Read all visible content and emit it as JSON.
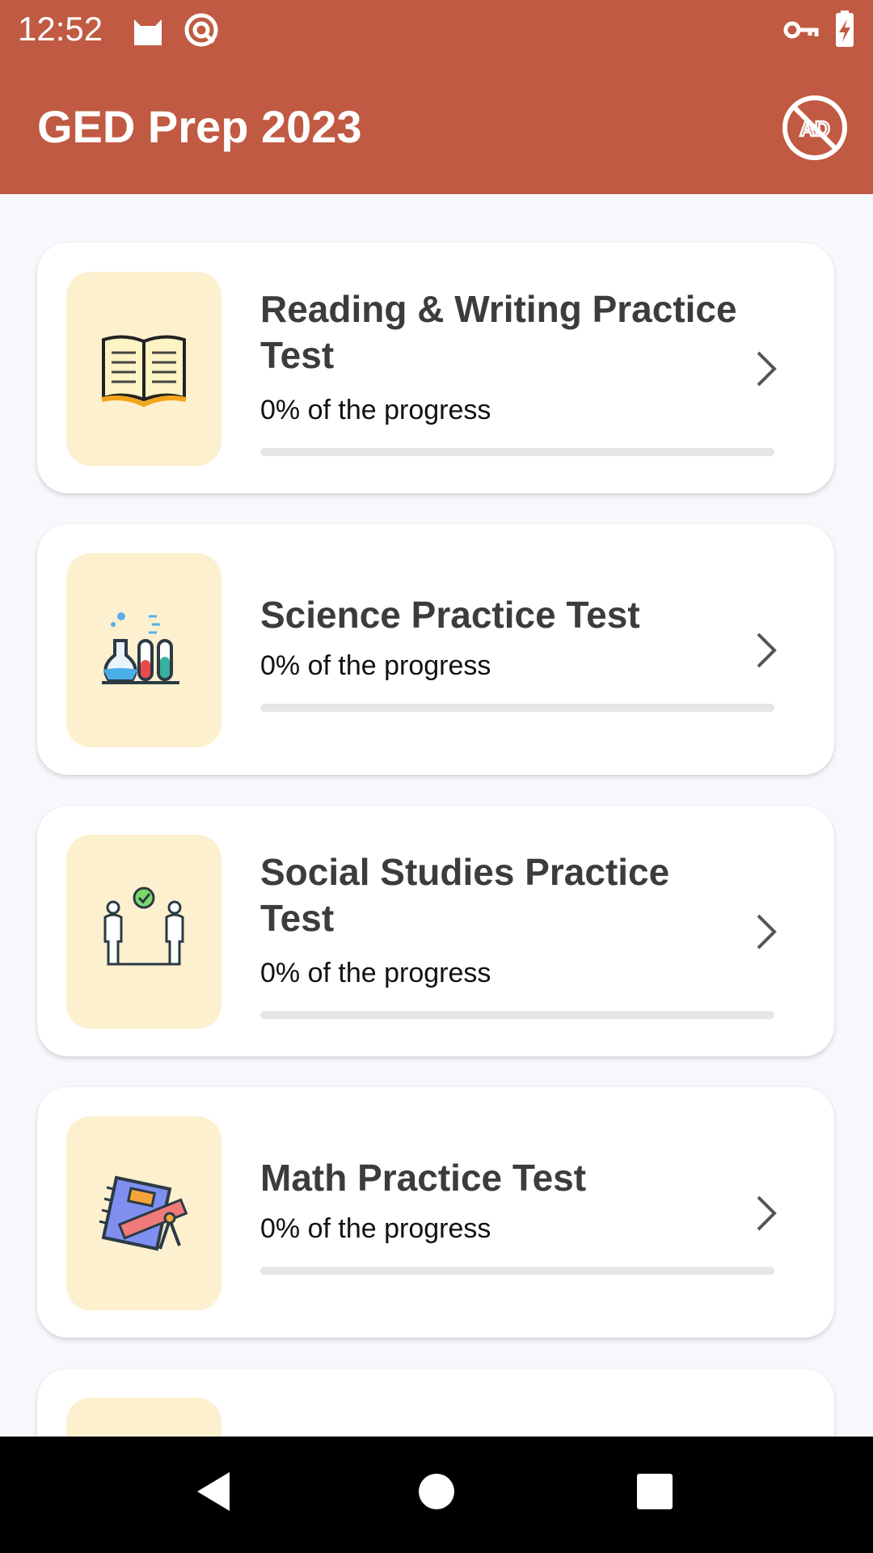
{
  "status_bar": {
    "time": "12:52",
    "icons": [
      "cat-icon",
      "at-sync-icon",
      "key-icon",
      "battery-charging-icon"
    ]
  },
  "app_bar": {
    "title": "GED Prep 2023",
    "action_icon": "no-ads-icon"
  },
  "colors": {
    "brand": "#c05a42",
    "tile_background": "#fdf0cf",
    "card_background": "#ffffff",
    "progress_track": "#e6e6e6"
  },
  "tests": [
    {
      "title": "Reading & Writing Practice Test",
      "progress_text": "0% of the progress",
      "progress": 0,
      "icon": "open-book-icon"
    },
    {
      "title": "Science Practice Test",
      "progress_text": "0% of the progress",
      "progress": 0,
      "icon": "lab-flasks-icon"
    },
    {
      "title": "Social Studies Practice Test",
      "progress_text": "0% of the progress",
      "progress": 0,
      "icon": "people-check-icon"
    },
    {
      "title": "Math Practice Test",
      "progress_text": "0% of the progress",
      "progress": 0,
      "icon": "notebook-ruler-compass-icon"
    }
  ],
  "nav_bar": {
    "buttons": [
      "back-icon",
      "home-icon",
      "recents-icon"
    ]
  }
}
